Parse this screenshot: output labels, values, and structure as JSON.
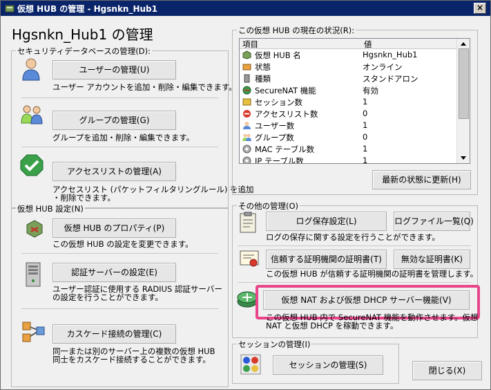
{
  "window": {
    "title": "仮想 HUB の管理 - Hgsnkn_Hub1",
    "close": "×"
  },
  "hub_title": "Hgsnkn_Hub1 の管理",
  "security": {
    "legend": "セキュリティデータベースの管理(D):",
    "users": {
      "button": "ユーザーの管理(U)",
      "desc": "ユーザー アカウントを追加・削除・編集できます。"
    },
    "groups": {
      "button": "グループの管理(G)",
      "desc": "グループを追加・削除・編集できます。"
    },
    "access": {
      "button": "アクセスリストの管理(A)",
      "desc1": "アクセスリスト (パケットフィルタリングルール) を追加",
      "desc2": "・削除できます。"
    }
  },
  "hubsettings": {
    "legend": "仮想 HUB 設定(N)",
    "props": {
      "button": "仮想 HUB のプロパティ(P)",
      "desc": "この仮想 HUB の設定を変更できます。"
    },
    "auth": {
      "button": "認証サーバーの設定(E)",
      "desc1": "ユーザー認証に使用する RADIUS 認証サーバー",
      "desc2": "の設定を行うことができます。"
    },
    "cascade": {
      "button": "カスケード接続の管理(C)",
      "desc1": "同一または別のサーバー上の複数の仮想 HUB",
      "desc2": "同士をカスケード接続することができます。"
    }
  },
  "status": {
    "legend": "この仮想 HUB の現在の状況(R):",
    "col_item": "項目",
    "col_value": "値",
    "rows": [
      {
        "item": "仮想 HUB 名",
        "value": "Hgsnkn_Hub1",
        "icon": "hub-icon"
      },
      {
        "item": "状態",
        "value": "オンライン",
        "icon": "status-icon"
      },
      {
        "item": "種類",
        "value": "スタンドアロン",
        "icon": "type-icon"
      },
      {
        "item": "SecureNAT 機能",
        "value": "有効",
        "icon": "securenat-icon"
      },
      {
        "item": "セッション数",
        "value": "1",
        "icon": "session-icon"
      },
      {
        "item": "アクセスリスト数",
        "value": "0",
        "icon": "access-list-icon"
      },
      {
        "item": "ユーザー数",
        "value": "1",
        "icon": "user-icon"
      },
      {
        "item": "グループ数",
        "value": "0",
        "icon": "group-icon"
      },
      {
        "item": "MAC テーブル数",
        "value": "1",
        "icon": "mac-table-icon"
      },
      {
        "item": "IP テーブル数",
        "value": "1",
        "icon": "ip-table-icon"
      }
    ],
    "refresh": "最新の状態に更新(H)"
  },
  "other": {
    "legend": "その他の管理(O)",
    "log_settings": "ログ保存設定(L)",
    "log_files": "ログファイル一覧(Q)",
    "log_desc": "ログの保存に関する設定を行うことができます。",
    "trusted_ca": "信頼する証明機関の証明書(T)",
    "invalid_cert": "無効な証明書(K)",
    "cert_desc": "この仮想 HUB が信頼する証明機関の証明書を管理します。",
    "nat": "仮想 NAT および仮想 DHCP サーバー機能(V)",
    "nat_desc1": "この仮想 HUB 内で SecureNAT 機能を動作させます。仮想",
    "nat_desc2": "NAT と仮想 DHCP を稼動できます。"
  },
  "session": {
    "legend": "セッションの管理(I)",
    "button": "セッションの管理(S)"
  },
  "close_button": "閉じる(X)",
  "colors": {
    "titlebar": "#0a246a",
    "highlight": "#e8458b",
    "background": "#f0f0f0"
  }
}
